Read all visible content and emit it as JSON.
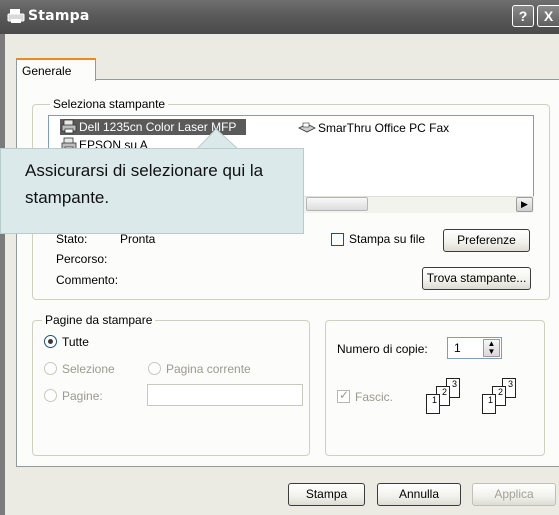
{
  "window": {
    "title": "Stampa",
    "help_label": "?",
    "close_label": "X"
  },
  "tabs": [
    {
      "label": "Generale"
    }
  ],
  "select_printer": {
    "group_label": "Seleziona stampante",
    "printers": [
      {
        "name": "Dell 1235cn Color Laser MFP",
        "icon": "printer-icon",
        "selected": true
      },
      {
        "name": "SmarThru Office PC Fax",
        "icon": "fax-icon",
        "selected": false
      },
      {
        "name": "EPSON su A",
        "icon": "printer-icon",
        "selected": false
      }
    ],
    "status_label": "Stato:",
    "status_value": "Pronta",
    "location_label": "Percorso:",
    "comment_label": "Commento:",
    "print_to_file_label": "Stampa su file",
    "preferences_label": "Preferenze",
    "find_printer_label": "Trova stampante..."
  },
  "callout": {
    "text": "Assicurarsi di selezionare qui la stampante."
  },
  "page_range": {
    "group_label": "Pagine da stampare",
    "all_label": "Tutte",
    "selection_label": "Selezione",
    "current_page_label": "Pagina corrente",
    "pages_label": "Pagine:",
    "pages_value": ""
  },
  "copies": {
    "count_label": "Numero di copie:",
    "count_value": "1",
    "collate_label": "Fascic.",
    "collate_checked": true,
    "page_numbers": [
      "1",
      "2",
      "3"
    ]
  },
  "footer": {
    "print_label": "Stampa",
    "cancel_label": "Annulla",
    "apply_label": "Applica"
  },
  "colors": {
    "selection": "#5a5a5a",
    "callout": "#dbe9ea",
    "titlebar": "#5a5a5a",
    "tab_accent": "#e68b2c"
  }
}
